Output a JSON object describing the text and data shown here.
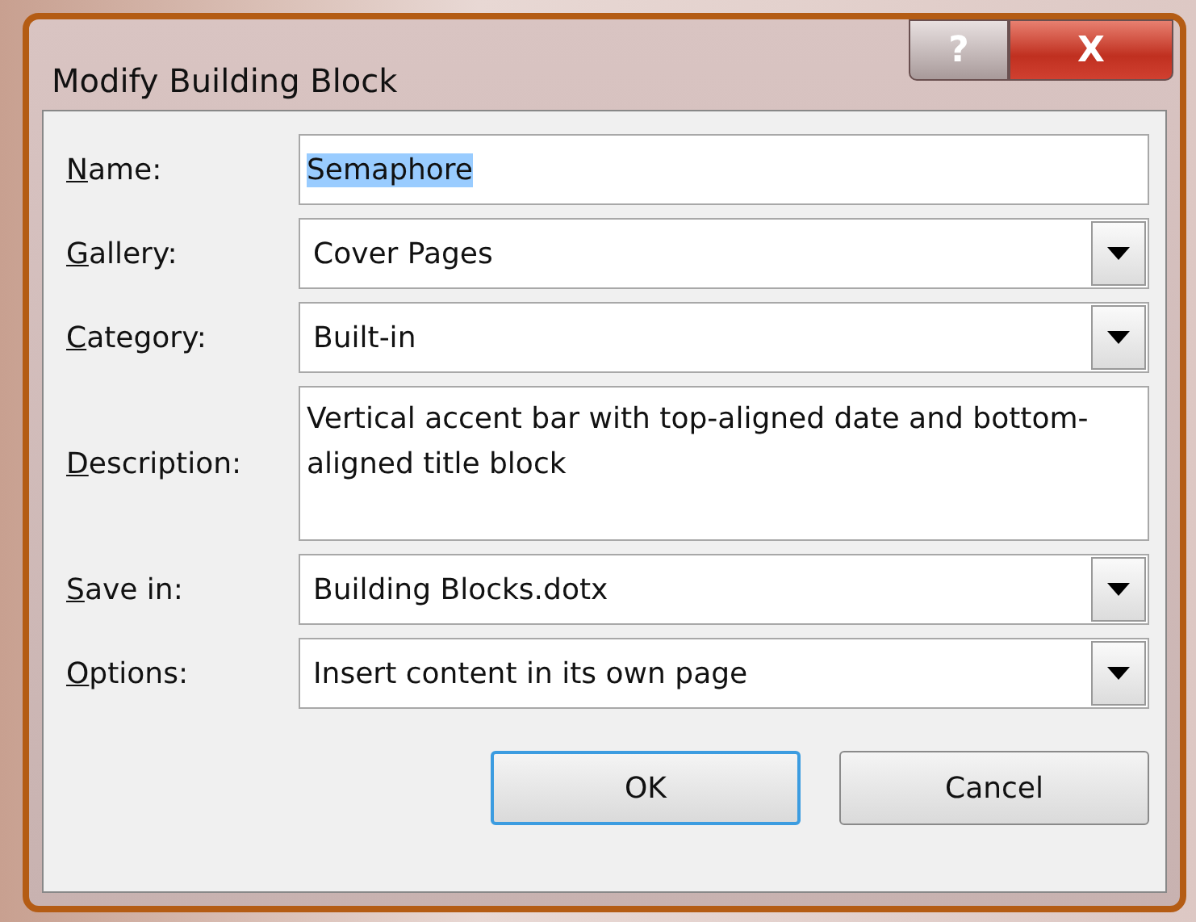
{
  "window": {
    "title": "Modify Building Block",
    "help_button": "?",
    "close_button": "X"
  },
  "fields": [
    {
      "label": "Name:",
      "kind": "text",
      "value": "Semaphore",
      "text_selected": true
    },
    {
      "label": "Gallery:",
      "kind": "combo",
      "value": "Cover Pages"
    },
    {
      "label": "Category:",
      "kind": "combo",
      "value": "Built-in"
    },
    {
      "label": "Description:",
      "kind": "memo",
      "value": "Vertical accent bar with top-aligned date and bottom-aligned title block"
    },
    {
      "label": "Save in:",
      "kind": "combo",
      "value": "Building Blocks.dotx"
    },
    {
      "label": "Options:",
      "kind": "combo",
      "value": "Insert content in its own page"
    }
  ],
  "buttons": [
    {
      "label": "OK",
      "default": true
    },
    {
      "label": "Cancel",
      "default": false
    }
  ]
}
